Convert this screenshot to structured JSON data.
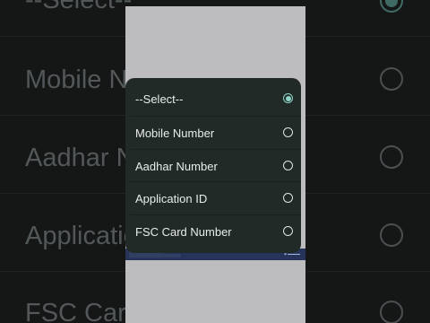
{
  "dialog": {
    "options": [
      {
        "label": "--Select--",
        "selected": true
      },
      {
        "label": "Mobile Number",
        "selected": false
      },
      {
        "label": "Aadhar Number",
        "selected": false
      },
      {
        "label": "Application ID",
        "selected": false
      },
      {
        "label": "FSC Card Number",
        "selected": false
      }
    ]
  },
  "background_zoom": {
    "rows": [
      "--Select--",
      "Mobile N",
      "Aadhar N",
      "Applicatio",
      "FSC Card"
    ]
  },
  "colors": {
    "accent": "#8fd6c8",
    "dialog_bg": "#222a28",
    "phone_bg": "#bdbdbf",
    "strip_bg": "#26345a"
  }
}
